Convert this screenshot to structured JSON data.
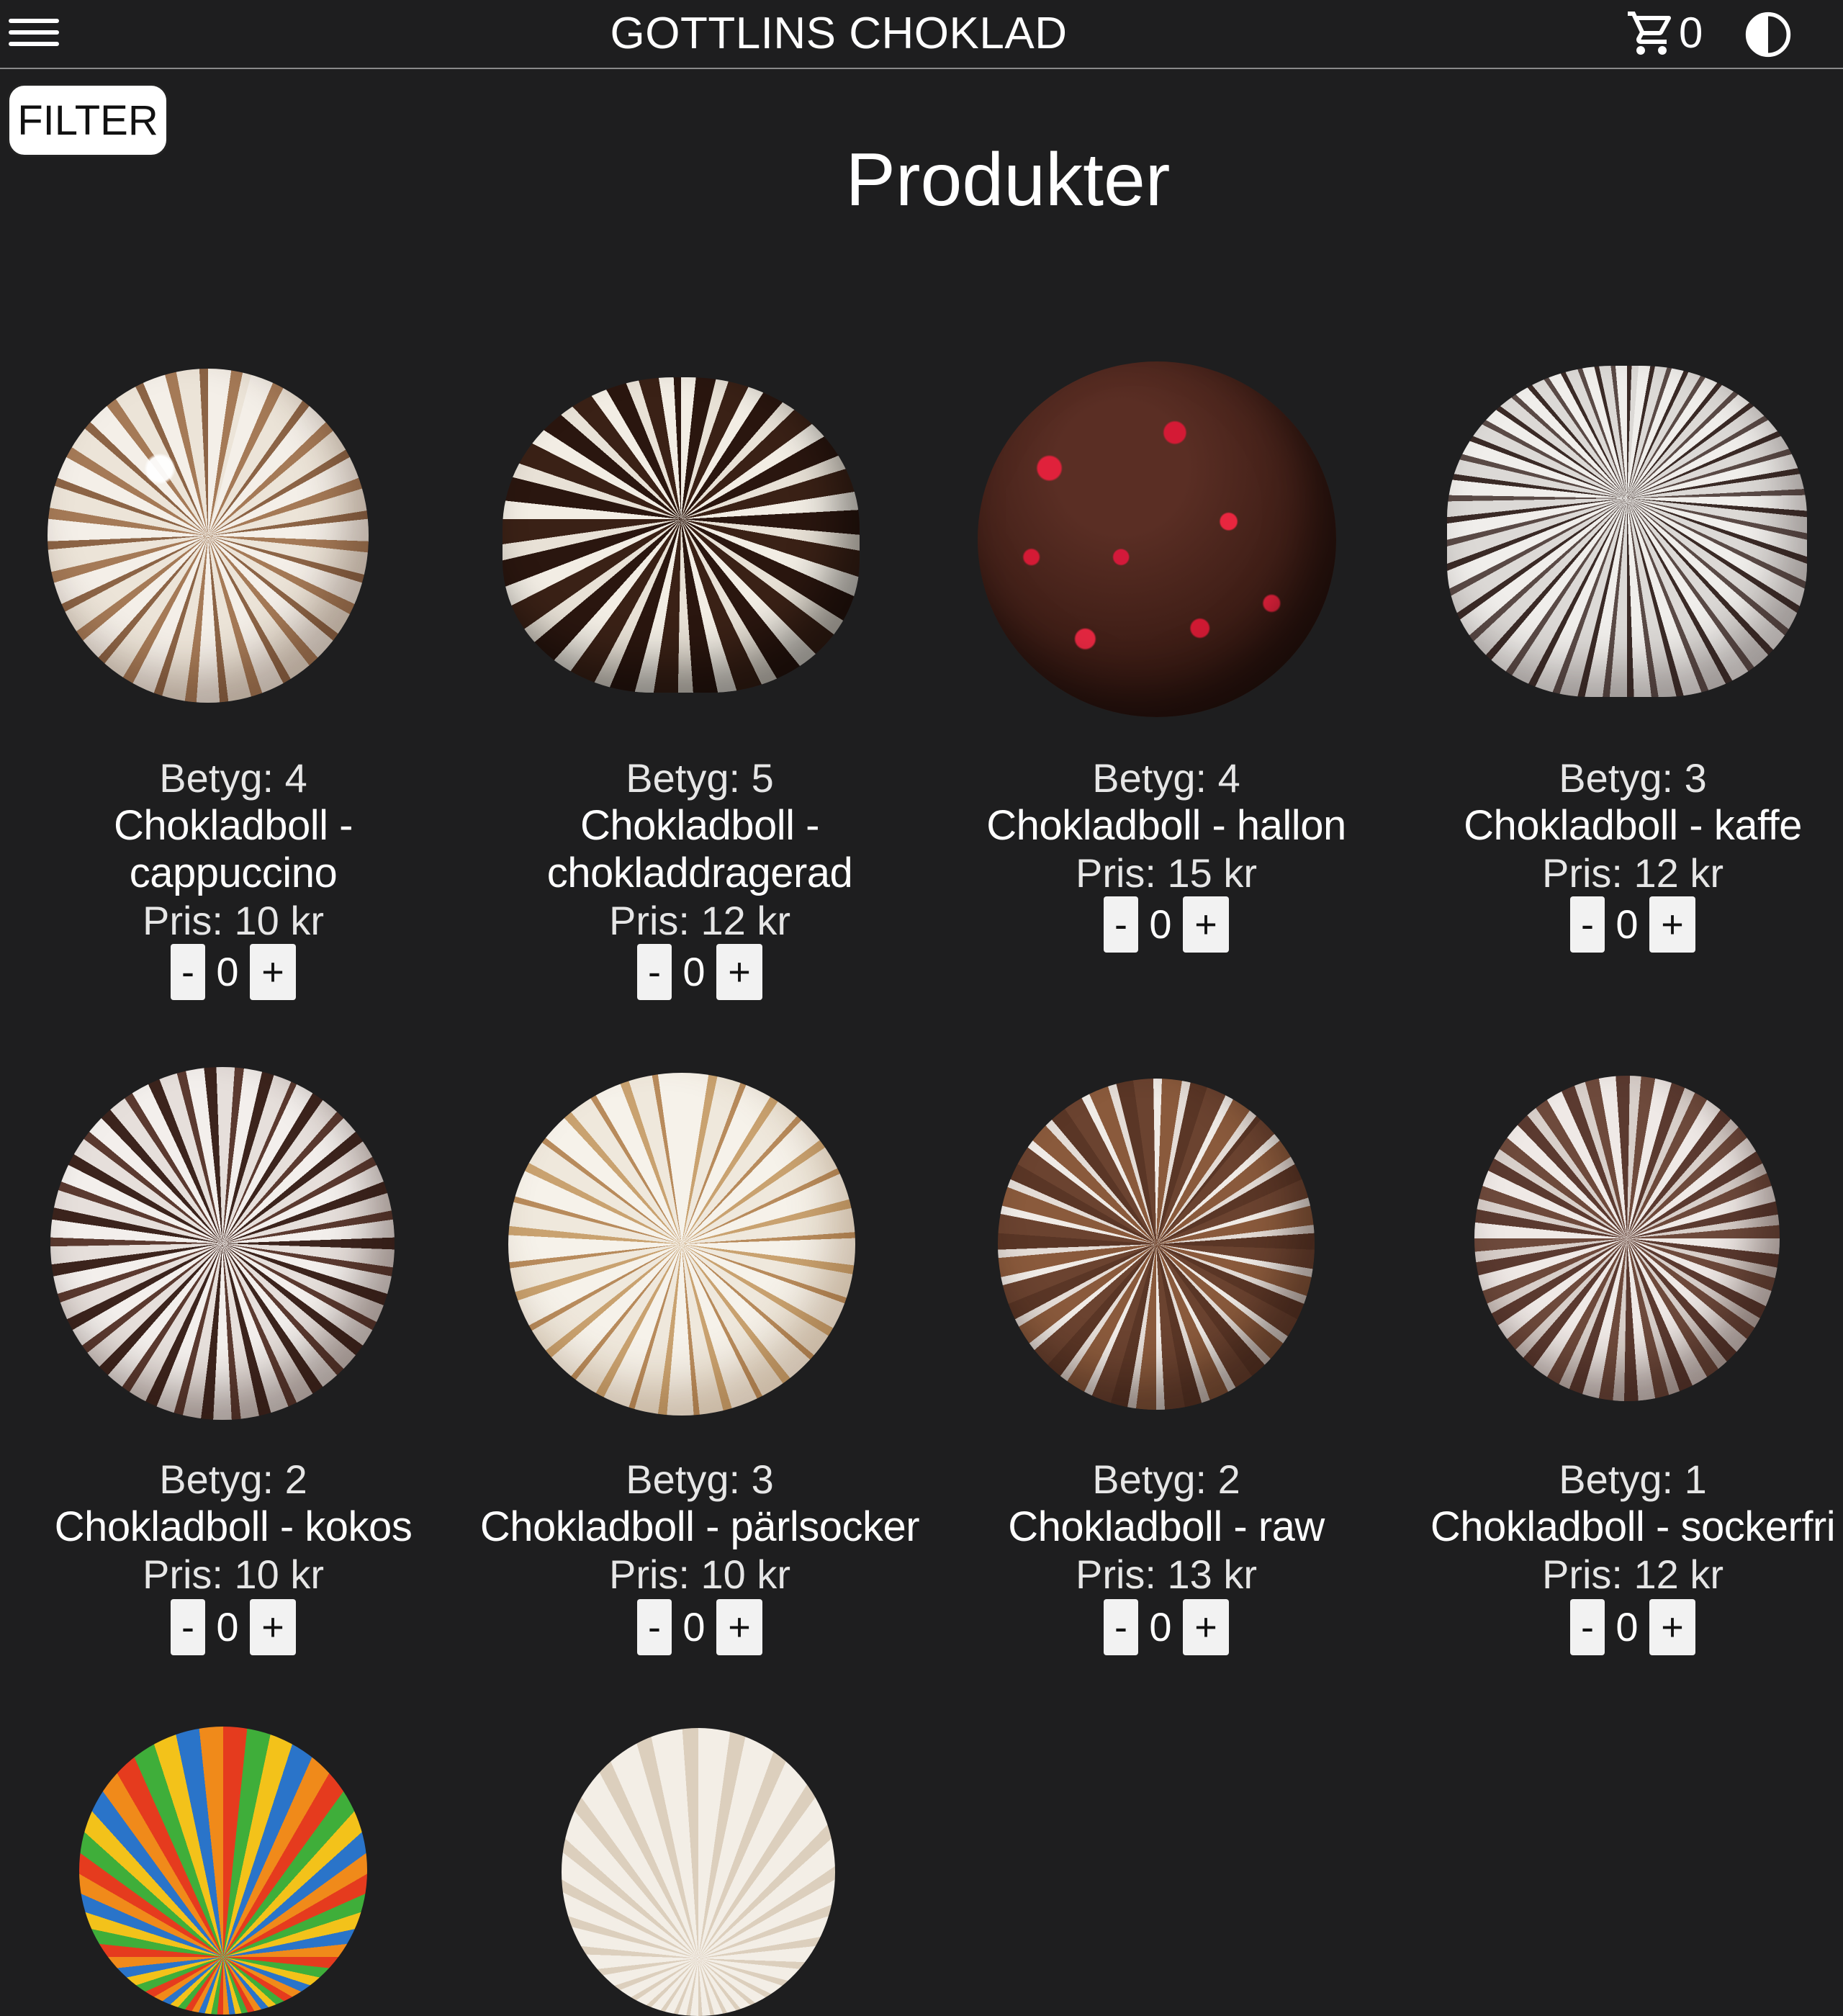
{
  "header": {
    "title": "GOTTLINS CHOKLAD",
    "cart_count": "0",
    "menu_icon": "hamburger-menu-icon",
    "cart_icon": "shopping-cart-icon",
    "theme_icon": "contrast-toggle-icon"
  },
  "filter": {
    "label": "FILTER"
  },
  "page": {
    "heading": "Produkter"
  },
  "colors": {
    "background": "#1e1e1f",
    "text": "#ffffff",
    "button": "#f2f2f2"
  },
  "products": [
    {
      "rating": "Betyg: 4",
      "name_line1": "Chokladboll -",
      "name_line2": "cappuccino",
      "price": "Pris: 10 kr",
      "qty": "0",
      "minus": "-",
      "plus": "+"
    },
    {
      "rating": "Betyg: 5",
      "name_line1": "Chokladboll -",
      "name_line2": "chokladdragerad",
      "price": "Pris: 12 kr",
      "qty": "0",
      "minus": "-",
      "plus": "+"
    },
    {
      "rating": "Betyg: 4",
      "name": "Chokladboll - hallon",
      "price": "Pris: 15 kr",
      "qty": "0",
      "minus": "-",
      "plus": "+"
    },
    {
      "rating": "Betyg: 3",
      "name": "Chokladboll - kaffe",
      "price": "Pris: 12 kr",
      "qty": "0",
      "minus": "-",
      "plus": "+"
    },
    {
      "rating": "Betyg: 2",
      "name": "Chokladboll - kokos",
      "price": "Pris: 10 kr",
      "qty": "0",
      "minus": "-",
      "plus": "+"
    },
    {
      "rating": "Betyg: 3",
      "name": "Chokladboll - pärlsocker",
      "price": "Pris: 10 kr",
      "qty": "0",
      "minus": "-",
      "plus": "+"
    },
    {
      "rating": "Betyg: 2",
      "name": "Chokladboll - raw",
      "price": "Pris: 13 kr",
      "qty": "0",
      "minus": "-",
      "plus": "+"
    },
    {
      "rating": "Betyg: 1",
      "name": "Chokladboll - sockerfri",
      "price": "Pris: 12 kr",
      "qty": "0",
      "minus": "-",
      "plus": "+"
    }
  ]
}
